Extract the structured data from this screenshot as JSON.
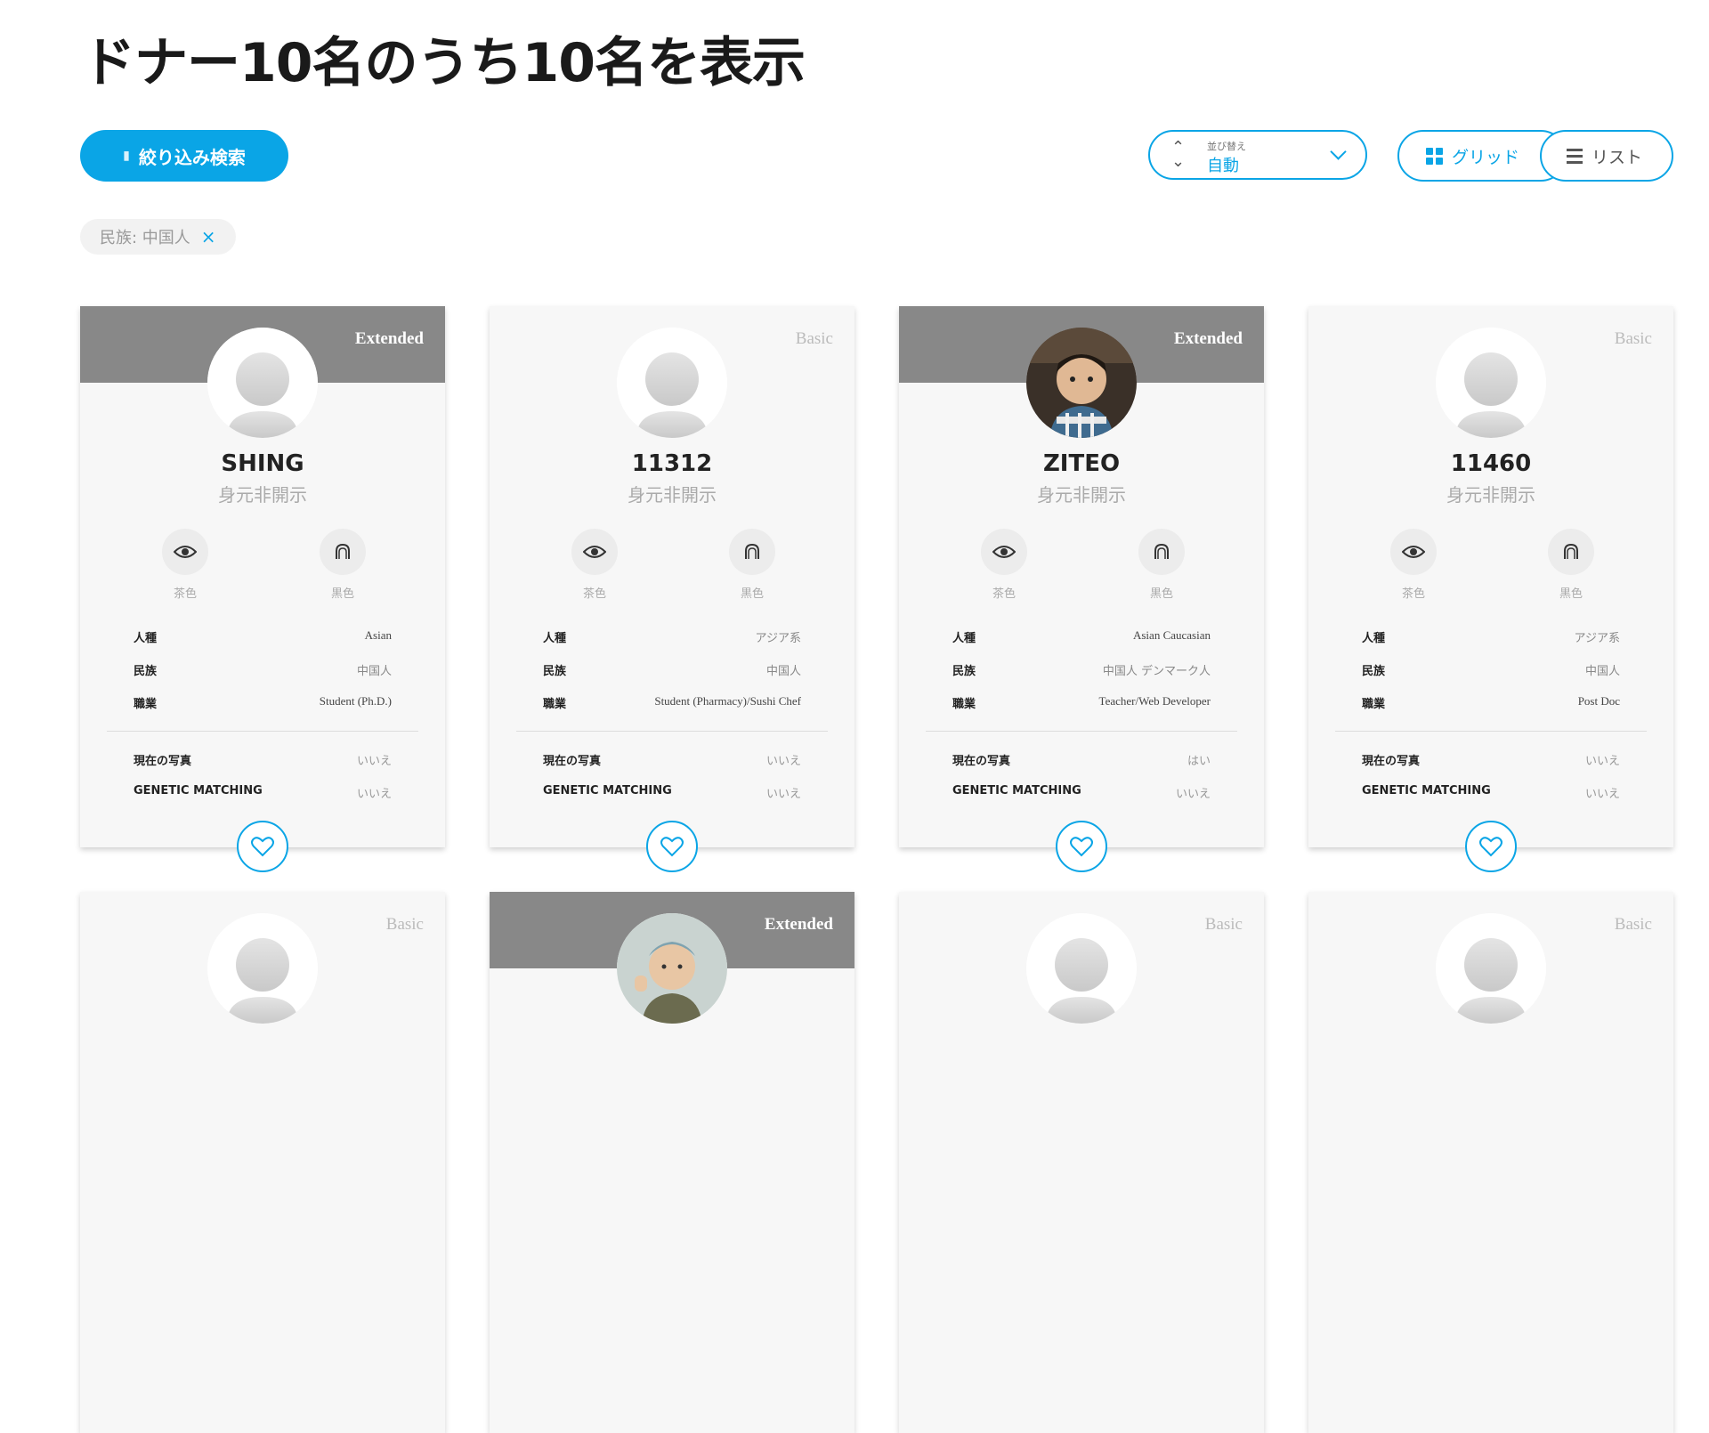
{
  "page": {
    "title": "ドナー10名のうち10名を表示"
  },
  "toolbar": {
    "filter_label": "絞り込み検索",
    "sort_label": "並び替え",
    "sort_value": "自動",
    "view_grid_label": "グリッド",
    "view_list_label": "リスト"
  },
  "active_filter": {
    "label": "民族: 中国人",
    "remove": "×"
  },
  "field_labels": {
    "race": "人種",
    "ethnicity": "民族",
    "occupation": "職業",
    "current_photo": "現在の写真",
    "genetic": "GENETIC MATCHING"
  },
  "donors": [
    {
      "name": "SHING",
      "subtitle": "身元非開示",
      "plan": "Extended",
      "photo": false,
      "eye_color": "茶色",
      "hair_color": "黒色",
      "race": "Asian",
      "ethnicity": "中国人",
      "occupation": "Student (Ph.D.)",
      "current_photo": "いいえ",
      "genetic_matching": "いいえ"
    },
    {
      "name": "11312",
      "subtitle": "身元非開示",
      "plan": "Basic",
      "photo": false,
      "eye_color": "茶色",
      "hair_color": "黒色",
      "race": "アジア系",
      "ethnicity": "中国人",
      "occupation": "Student (Pharmacy)/Sushi Chef",
      "current_photo": "いいえ",
      "genetic_matching": "いいえ"
    },
    {
      "name": "ZITEO",
      "subtitle": "身元非開示",
      "plan": "Extended",
      "photo": true,
      "eye_color": "茶色",
      "hair_color": "黒色",
      "race": "Asian Caucasian",
      "ethnicity": "中国人 デンマーク人",
      "occupation": "Teacher/Web Developer",
      "current_photo": "はい",
      "genetic_matching": "いいえ"
    },
    {
      "name": "11460",
      "subtitle": "身元非開示",
      "plan": "Basic",
      "photo": false,
      "eye_color": "茶色",
      "hair_color": "黒色",
      "race": "アジア系",
      "ethnicity": "中国人",
      "occupation": "Post Doc",
      "current_photo": "いいえ",
      "genetic_matching": "いいえ"
    }
  ],
  "donors_row2": [
    {
      "plan": "Basic",
      "photo": false
    },
    {
      "plan": "Extended",
      "photo": true
    },
    {
      "plan": "Basic",
      "photo": false
    },
    {
      "plan": "Basic",
      "photo": false
    }
  ],
  "colors": {
    "accent": "#0aa5e6",
    "extended_band": "#888888",
    "card_bg": "#f7f7f7"
  }
}
